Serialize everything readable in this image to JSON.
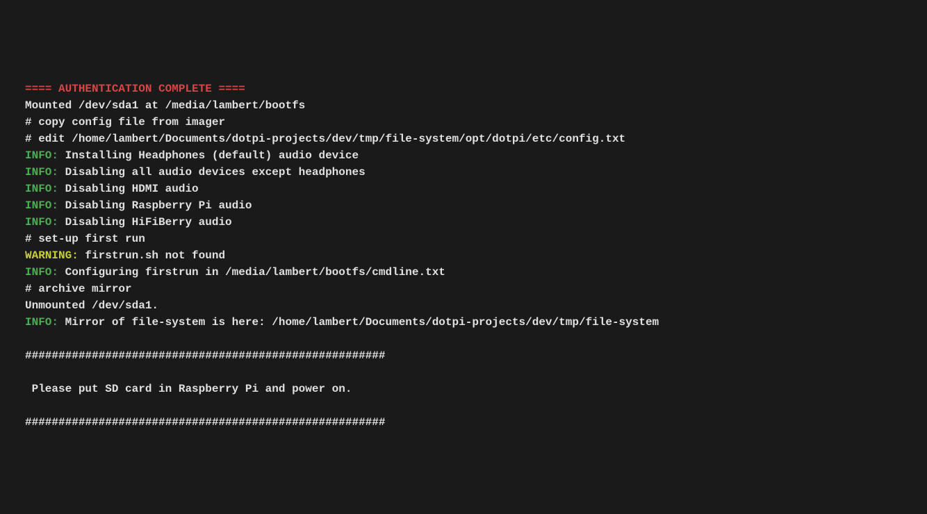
{
  "lines": [
    {
      "segments": [
        {
          "cls": "red",
          "text": "==== AUTHENTICATION COMPLETE ===="
        }
      ]
    },
    {
      "segments": [
        {
          "cls": "white",
          "text": "Mounted /dev/sda1 at /media/lambert/bootfs"
        }
      ]
    },
    {
      "segments": [
        {
          "cls": "white",
          "text": "# copy config file from imager"
        }
      ]
    },
    {
      "segments": [
        {
          "cls": "white",
          "text": "# edit /home/lambert/Documents/dotpi-projects/dev/tmp/file-system/opt/dotpi/etc/config.txt"
        }
      ]
    },
    {
      "segments": [
        {
          "cls": "green",
          "text": "INFO:"
        },
        {
          "cls": "white",
          "text": " Installing Headphones (default) audio device"
        }
      ]
    },
    {
      "segments": [
        {
          "cls": "green",
          "text": "INFO:"
        },
        {
          "cls": "white",
          "text": " Disabling all audio devices except headphones"
        }
      ]
    },
    {
      "segments": [
        {
          "cls": "green",
          "text": "INFO:"
        },
        {
          "cls": "white",
          "text": " Disabling HDMI audio"
        }
      ]
    },
    {
      "segments": [
        {
          "cls": "green",
          "text": "INFO:"
        },
        {
          "cls": "white",
          "text": " Disabling Raspberry Pi audio"
        }
      ]
    },
    {
      "segments": [
        {
          "cls": "green",
          "text": "INFO:"
        },
        {
          "cls": "white",
          "text": " Disabling HiFiBerry audio"
        }
      ]
    },
    {
      "segments": [
        {
          "cls": "white",
          "text": "# set-up first run"
        }
      ]
    },
    {
      "segments": [
        {
          "cls": "yellow",
          "text": "WARNING:"
        },
        {
          "cls": "white",
          "text": " firstrun.sh not found"
        }
      ]
    },
    {
      "segments": [
        {
          "cls": "green",
          "text": "INFO:"
        },
        {
          "cls": "white",
          "text": " Configuring firstrun in /media/lambert/bootfs/cmdline.txt"
        }
      ]
    },
    {
      "segments": [
        {
          "cls": "white",
          "text": "# archive mirror"
        }
      ]
    },
    {
      "segments": [
        {
          "cls": "white",
          "text": "Unmounted /dev/sda1."
        }
      ]
    },
    {
      "segments": [
        {
          "cls": "green",
          "text": "INFO:"
        },
        {
          "cls": "white",
          "text": " Mirror of file-system is here: /home/lambert/Documents/dotpi-projects/dev/tmp/file-system"
        }
      ]
    },
    {
      "segments": [
        {
          "cls": "white",
          "text": ""
        }
      ]
    },
    {
      "segments": [
        {
          "cls": "white",
          "text": "######################################################"
        }
      ]
    },
    {
      "segments": [
        {
          "cls": "white",
          "text": ""
        }
      ]
    },
    {
      "segments": [
        {
          "cls": "white",
          "text": " Please put SD card in Raspberry Pi and power on."
        }
      ]
    },
    {
      "segments": [
        {
          "cls": "white",
          "text": ""
        }
      ]
    },
    {
      "segments": [
        {
          "cls": "white",
          "text": "######################################################"
        }
      ]
    }
  ]
}
